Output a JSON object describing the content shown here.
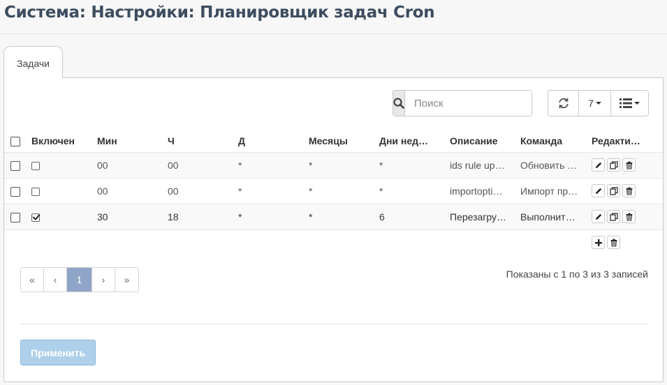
{
  "page": {
    "title": "Система: Настройки: Планировщик задач Cron"
  },
  "tabs": [
    {
      "label": "Задачи",
      "active": true
    }
  ],
  "toolbar": {
    "search_placeholder": "Поиск",
    "search_value": "",
    "page_size": "7",
    "refresh_icon": "refresh-icon",
    "columns_icon": "list-columns-icon"
  },
  "table": {
    "columns": [
      "Включен",
      "Мин",
      "Ч",
      "Д",
      "Месяцы",
      "Дни нед…",
      "Описание",
      "Команда",
      "Редакти…"
    ],
    "rows": [
      {
        "enabled": false,
        "minute": "00",
        "hour": "00",
        "day": "*",
        "month": "*",
        "weekday": "*",
        "description": "ids rule up…",
        "command": "Обновить …"
      },
      {
        "enabled": false,
        "minute": "00",
        "hour": "00",
        "day": "*",
        "month": "*",
        "weekday": "*",
        "description": "importopti…",
        "command": "Импорт пр…"
      },
      {
        "enabled": true,
        "minute": "30",
        "hour": "18",
        "day": "*",
        "month": "*",
        "weekday": "6",
        "description": "Перезагру…",
        "command": "Выполнит…"
      }
    ]
  },
  "pagination": {
    "first": "«",
    "prev": "‹",
    "current": "1",
    "next": "›",
    "last": "»",
    "summary": "Показаны с 1 по 3 из 3 записей"
  },
  "footer": {
    "apply_label": "Применить"
  },
  "colors": {
    "accent": "#8fa5c7",
    "apply_bg": "#aed0ea",
    "title": "#3d4d5f"
  }
}
